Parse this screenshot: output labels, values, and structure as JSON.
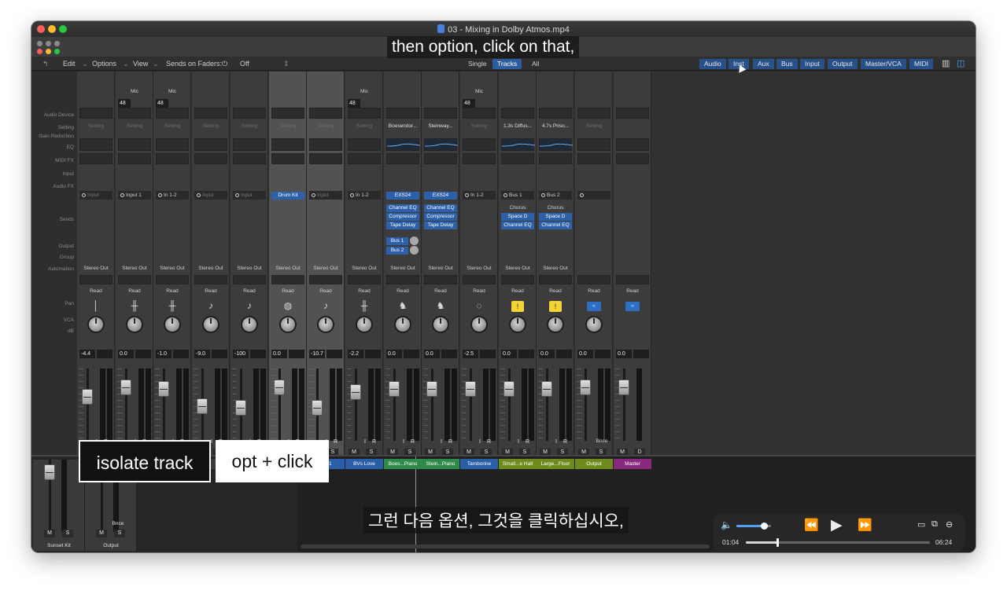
{
  "window": {
    "title": "03 - Mixing in Dolby Atmos.mp4"
  },
  "toolbar": {
    "edit": "Edit",
    "options": "Options",
    "view": "View",
    "sends_on_faders": "Sends on Faders:",
    "sends_value": "Off",
    "view_modes": [
      "Single",
      "Tracks",
      "All"
    ],
    "active_view": "Tracks",
    "filters": [
      "Audio",
      "Inst",
      "Aux",
      "Bus",
      "Input",
      "Output",
      "Master/VCA",
      "MIDI"
    ]
  },
  "row_labels": {
    "audio_device": "Audio Device",
    "setting": "Setting",
    "gain_reduction": "Gain Reduction",
    "eq": "EQ",
    "midi_fx": "MIDI FX",
    "input": "Input",
    "audio_fx": "Audio FX",
    "sends": "Sends",
    "output": "Output",
    "group": "Group",
    "automation": "Automation",
    "pan": "Pan",
    "vca": "VCA",
    "db": "dB"
  },
  "strips": [
    {
      "mic": "",
      "setting": "Setting",
      "input": "Input",
      "output": "Stereo Out",
      "automation": "Read",
      "volume": "-4.4",
      "name": "",
      "name_color": "#3a3a3a",
      "icon": "│",
      "bnce": "",
      "fx": [],
      "sends": []
    },
    {
      "mic": "Mic",
      "gain": "48",
      "trim": "0",
      "setting": "Setting",
      "input": "Input 1",
      "output": "Stereo Out",
      "automation": "Read",
      "volume": "0.0",
      "name": "",
      "name_color": "#3a3a3a",
      "icon": "╫",
      "bnce": "",
      "fx": [],
      "sends": []
    },
    {
      "mic": "Mic",
      "gain": "48",
      "trim": "0",
      "setting": "Setting",
      "input": "In 1-2",
      "output": "Stereo Out",
      "automation": "Read",
      "volume": "-1.0",
      "name": "",
      "name_color": "#3a3a3a",
      "icon": "╫",
      "bnce": "",
      "fx": [],
      "sends": []
    },
    {
      "mic": "",
      "setting": "Setting",
      "input": "Input",
      "output": "Stereo Out",
      "automation": "Read",
      "volume": "-9.0",
      "name": "",
      "name_color": "#3a3a3a",
      "icon": "♪",
      "bnce": "",
      "fx": [],
      "sends": []
    },
    {
      "mic": "",
      "setting": "Setting",
      "input": "Input",
      "output": "Stereo Out",
      "automation": "Read",
      "volume": "-100",
      "name": "",
      "name_color": "#3a3a3a",
      "icon": "♪",
      "bnce": "",
      "fx": [],
      "sends": []
    },
    {
      "mic": "",
      "setting": "Setting",
      "input": "Drum Kit",
      "input_blue": true,
      "output": "Stereo Out",
      "automation": "Read",
      "volume": "0.0",
      "name": "",
      "name_color": "#2a7a36",
      "icon": "◍",
      "bnce": "",
      "fx": [],
      "sends": [],
      "selected": true
    },
    {
      "mic": "",
      "setting": "Setting",
      "input": "Input",
      "output": "Stereo Out",
      "automation": "Read",
      "volume": "-10.7",
      "name": "S_01",
      "name_color": "#2a5ea6",
      "icon": "♪",
      "bnce": "",
      "fx": [],
      "sends": [],
      "selected": true
    },
    {
      "mic": "Mic",
      "gain": "48",
      "trim": "0",
      "setting": "Setting",
      "input": "In 1-2",
      "output": "Stereo Out",
      "automation": "Read",
      "volume": "-2.2",
      "name": "BVs Love",
      "name_color": "#2a5ea6",
      "icon": "╫",
      "bnce": "",
      "fx": [],
      "sends": []
    },
    {
      "mic": "",
      "setting": "Boesendor...",
      "input": "EXS24",
      "input_blue": true,
      "output": "Stereo Out",
      "automation": "Read",
      "volume": "0.0",
      "name": "Boes...Piano",
      "name_color": "#2e8a4a",
      "icon": "♞",
      "bnce": "",
      "fx": [
        "Channel EQ",
        "Compressor",
        "Tape Delay"
      ],
      "sends": [
        "Bus 1",
        "Bus 2"
      ],
      "eq_curve": true
    },
    {
      "mic": "",
      "setting": "Steinway...",
      "input": "EXS24",
      "input_blue": true,
      "output": "Stereo Out",
      "automation": "Read",
      "volume": "0.0",
      "name": "Stein...Piano",
      "name_color": "#2e8a4a",
      "icon": "♞",
      "bnce": "",
      "fx": [
        "Channel EQ",
        "Compressor",
        "Tape Delay"
      ],
      "sends": [],
      "eq_curve": true
    },
    {
      "mic": "Mic",
      "gain": "48",
      "trim": "0",
      "setting": "Setting",
      "input": "In 1-2",
      "output": "Stereo Out",
      "automation": "Read",
      "volume": "-2.5",
      "name": "Tamborine",
      "name_color": "#2a5ea6",
      "icon": "◌",
      "bnce": "",
      "fx": [],
      "sends": []
    },
    {
      "mic": "",
      "setting": "1.3s Diffus...",
      "input": "Bus 1",
      "output": "Stereo Out",
      "automation": "Read",
      "volume": "0.0",
      "name": "Small...e Hall",
      "name_color": "#6e8c1e",
      "icon": "Y",
      "bnce": "",
      "fx": [
        "Chorus",
        "Space D",
        "Channel EQ"
      ],
      "sends": [],
      "eq_curve": true,
      "fx_first_plain": true
    },
    {
      "mic": "",
      "setting": "4.7s Priso...",
      "input": "Bus 2",
      "output": "Stereo Out",
      "automation": "Read",
      "volume": "0.0",
      "name": "Large...Floor",
      "name_color": "#6e8c1e",
      "icon": "Y",
      "bnce": "",
      "fx": [
        "Chorus",
        "Space D",
        "Channel EQ"
      ],
      "sends": [],
      "eq_curve": true,
      "fx_first_plain": true
    },
    {
      "mic": "",
      "setting": "Setting",
      "input": "",
      "output": "",
      "automation": "Read",
      "volume": "0.0",
      "name": "Output",
      "name_color": "#6e8c1e",
      "icon": "wave",
      "bnce": "Bnce",
      "fx": [],
      "sends": []
    },
    {
      "mic": "",
      "setting": "",
      "input": "",
      "output": "",
      "automation": "Read",
      "volume": "0.0",
      "name": "Master",
      "name_color": "#8a2a7e",
      "icon": "wave",
      "bnce": "",
      "fx": [],
      "sends": [],
      "master": true
    }
  ],
  "lower_strips": [
    {
      "name": "Sunset Kit",
      "bnce": ""
    },
    {
      "name": "Output",
      "bnce": "Bnce"
    }
  ],
  "buttons": {
    "mute": "M",
    "solo": "S",
    "dim": "D",
    "input_mon": "I",
    "rec": "R"
  },
  "overlays": {
    "isolate": "isolate track",
    "opt_click": "opt + click",
    "subtitle_en": "then option, click on that,",
    "subtitle_ko": "그런 다음 옵션, 그것을 클릭하십시오,"
  },
  "player": {
    "elapsed": "01:04",
    "remaining": "06:24",
    "progress": 0.17,
    "volume": 0.8
  }
}
